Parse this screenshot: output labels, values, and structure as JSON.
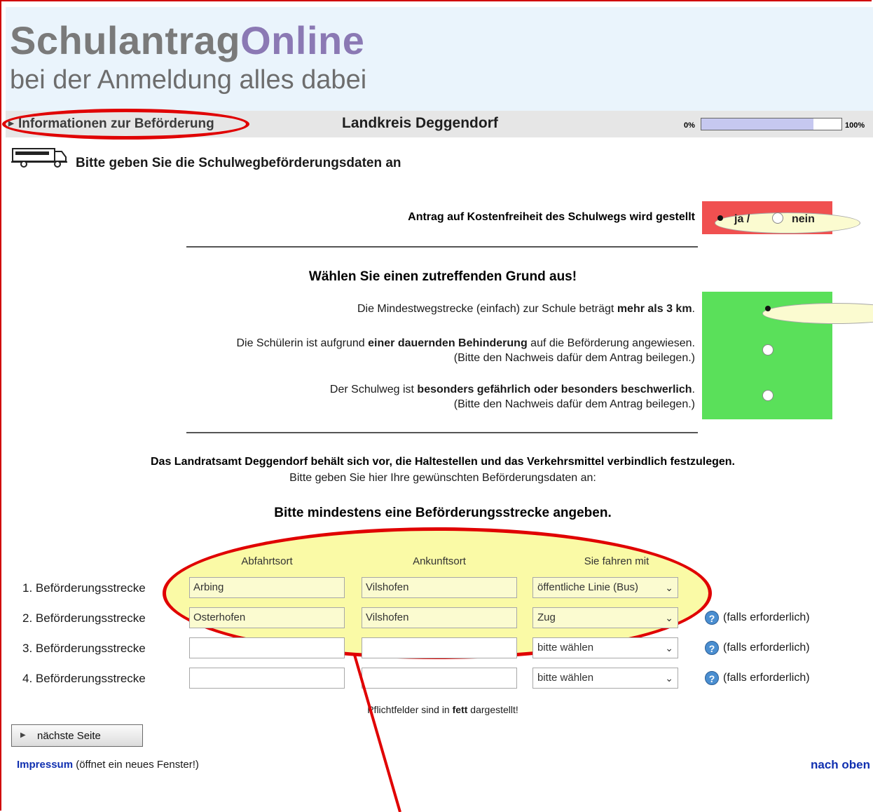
{
  "header": {
    "logo_part1": "Schulantrag",
    "logo_part2": "Online",
    "subtitle": "bei der Anmeldung alles dabei"
  },
  "navbar": {
    "section": "Informationen zur Beförderung",
    "district": "Landkreis Deggendorf",
    "progress_min": "0%",
    "progress_max": "100%",
    "progress_value": 0.8
  },
  "page_heading": "Bitte geben Sie die Schulwegbeförderungsdaten an",
  "antrag": {
    "label": "Antrag auf Kostenfreiheit des Schulwegs wird gestellt",
    "yes_label": "ja /",
    "no_label": "nein",
    "selected": "ja"
  },
  "grund": {
    "heading": "Wählen Sie einen zutreffenden Grund aus!",
    "reasons": [
      {
        "pre": "Die Mindestwegstrecke (einfach) zur Schule beträgt ",
        "bold": "mehr als 3 km",
        "post": ".",
        "note": "",
        "selected": true
      },
      {
        "pre": "Die Schülerin ist aufgrund ",
        "bold": "einer dauernden Behinderung",
        "post": " auf die Beförderung angewiesen.",
        "note": "(Bitte den Nachweis dafür dem Antrag beilegen.)",
        "selected": false
      },
      {
        "pre": "Der Schulweg ist ",
        "bold": "besonders gefährlich oder besonders beschwerlich",
        "post": ".",
        "note": "(Bitte den Nachweis dafür dem Antrag beilegen.)",
        "selected": false
      }
    ]
  },
  "info": {
    "line1": "Das Landratsamt Deggendorf behält sich vor, die Haltestellen und das Verkehrsmittel verbindlich festzulegen.",
    "line2": "Bitte geben Sie hier Ihre gewünschten Beförderungsdaten an:",
    "line3": "Bitte mindestens eine Beförderungsstrecke angeben."
  },
  "table": {
    "headers": [
      "Abfahrtsort",
      "Ankunftsort",
      "Sie fahren mit"
    ],
    "rows": [
      {
        "label": "1. Beförderungsstrecke",
        "from": "Arbing",
        "to": "Vilshofen",
        "mode": "öffentliche Linie (Bus)",
        "note": ""
      },
      {
        "label": "2. Beförderungsstrecke",
        "from": "Osterhofen",
        "to": "Vilshofen",
        "mode": "Zug",
        "note": "(falls erforderlich)"
      },
      {
        "label": "3. Beförderungsstrecke",
        "from": "",
        "to": "",
        "mode": "bitte wählen",
        "note": "(falls erforderlich)"
      },
      {
        "label": "4. Beförderungsstrecke",
        "from": "",
        "to": "",
        "mode": "bitte wählen",
        "note": "(falls erforderlich)"
      }
    ]
  },
  "footer": {
    "pflicht_pre": "Pflichtfelder sind in ",
    "pflicht_bold": "fett",
    "pflicht_post": " dargestellt!",
    "next_label": "nächste Seite",
    "impressum_link": "Impressum",
    "impressum_note": " (öffnet ein neues Fenster!)",
    "top_link": "nach oben"
  },
  "colors": {
    "antrag_bg": "#f05050",
    "grund_bg": "#5ae05a",
    "highlight_fill": "#fafaa6",
    "annotation_red": "#e00000",
    "link_blue": "#1030b0"
  }
}
